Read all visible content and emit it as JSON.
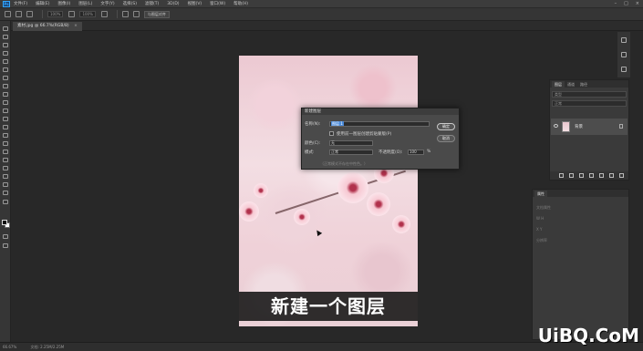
{
  "app": {
    "logo": "Ps"
  },
  "menu": [
    "文件(F)",
    "编辑(E)",
    "图像(I)",
    "图层(L)",
    "文字(Y)",
    "选择(S)",
    "滤镜(T)",
    "3D(D)",
    "视图(V)",
    "窗口(W)",
    "帮助(H)"
  ],
  "window_controls": [
    "–",
    "□",
    "×"
  ],
  "options": {
    "field1": "100%",
    "field2": "100%",
    "button": "与图层对齐"
  },
  "document": {
    "tab_title": "素材.jpg @ 66.7%(RGB/8)",
    "close": "×"
  },
  "subtitle": "新建一个图层",
  "dialog": {
    "title": "新建图层",
    "name_label": "名称(N):",
    "name_value": "图层 1",
    "clip_label": "使用前一图层创建剪贴蒙版(P)",
    "color_label": "颜色(C):",
    "color_value": "无",
    "mode_label": "模式:",
    "mode_value": "正常",
    "opacity_label": "不透明度(O):",
    "opacity_value": "100",
    "opacity_unit": "%",
    "note": "（正常模式不存在中性色。）",
    "ok": "确定",
    "cancel": "取消"
  },
  "layers_panel": {
    "tabs": [
      "图层",
      "通道",
      "路径"
    ],
    "kind": "类型",
    "blend": "正常",
    "layer_name": "背景"
  },
  "properties_panel": {
    "title": "属性",
    "lines": [
      "文档属性",
      "W  H",
      "X  Y",
      "分辨率"
    ]
  },
  "status": {
    "zoom": "66.67%",
    "doc": "文档: 2.25M/2.25M"
  },
  "watermark": "UiBQ.CoM"
}
